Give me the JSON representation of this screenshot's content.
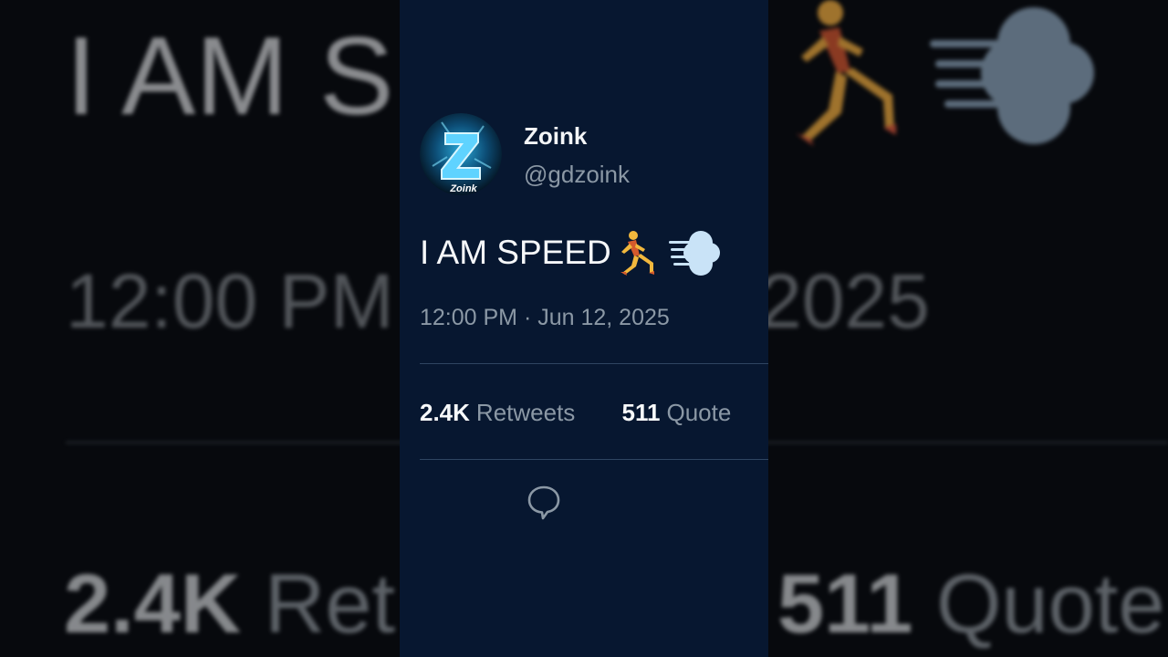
{
  "tweet": {
    "display_name": "Zoink",
    "handle": "@gdzoink",
    "avatar_label": "Zoink",
    "text": "I AM SPEED",
    "emojis": [
      "runner-icon",
      "dash-icon"
    ],
    "timestamp": "12:00 PM · Jun 12, 2025",
    "retweets_count": "2.4K",
    "retweets_label": "Retweets",
    "quotes_count": "511",
    "quotes_label": "Quote"
  },
  "background": {
    "title_fragment": "I AM S",
    "time_left": "12:00 PM",
    "time_right": "2025",
    "stat_left_count": "2.4K",
    "stat_left_label": "Ret",
    "stat_right_count": "511",
    "stat_right_label": "Quote"
  },
  "colors": {
    "card_background": "#071730",
    "text_primary": "#f3f5f7",
    "text_secondary": "#8b98a5",
    "divider": "#2f4561"
  }
}
